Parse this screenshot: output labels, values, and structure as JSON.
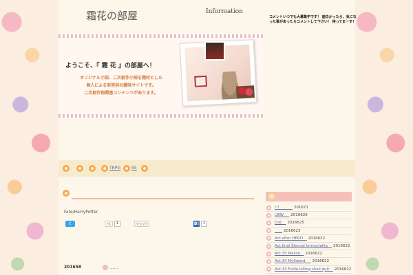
{
  "site": {
    "title": "霜花の部屋",
    "info_heading": "Information",
    "info_text": "コメントいつでも大募集中です！ 面白かったら、気になった事があったらコメントして下さい！ 待ってまーす！"
  },
  "banner": {
    "welcome": "ようこそ、『 霜 花 』の部屋へ！",
    "lines": [
      "オリジナル小説、二次創作小説を題材とした",
      "個人による非営利の趣味サイトです。",
      "二次創作物関連コンテンツがあります。"
    ]
  },
  "nav": {
    "items": [
      {
        "label": ""
      },
      {
        "label": ""
      },
      {
        "label": ""
      },
      {
        "label": "TRPG"
      },
      {
        "label": "SS"
      },
      {
        "label": ""
      }
    ]
  },
  "main": {
    "post_title": "Fate/HarryPotter",
    "share": {
      "tweet_label": "t",
      "gplus_label": "+1",
      "gplus_count": "1",
      "check_label": "チェック",
      "hatena_label": "B!",
      "hatena_count": "1"
    },
    "archive": {
      "date": "201658",
      "text": "......"
    }
  },
  "sidebar": {
    "items": [
      {
        "link": "!!!_______",
        "date": "201671"
      },
      {
        "link": "UBW___",
        "date": "2016626"
      },
      {
        "link": "CoC__",
        "date": "2016625"
      },
      {
        "link": "____",
        "date": "2016623"
      },
      {
        "link": "Act.after HERO__",
        "date": "2016622"
      },
      {
        "link": "Act.final Eternal Immortality__",
        "date": "2016622"
      },
      {
        "link": "Act.35 Malice__",
        "date": "2016622"
      },
      {
        "link": "Act.34 MySword___",
        "date": "2016622"
      },
      {
        "link": "Act.33 Futile killing shall quit__",
        "date": "2016622"
      }
    ]
  },
  "colors": {
    "accent_orange": "#f6a94f",
    "nav_bar": "#f6ebcd",
    "sidebar_head": "#f5c0b8",
    "link": "#5a6aa8"
  }
}
